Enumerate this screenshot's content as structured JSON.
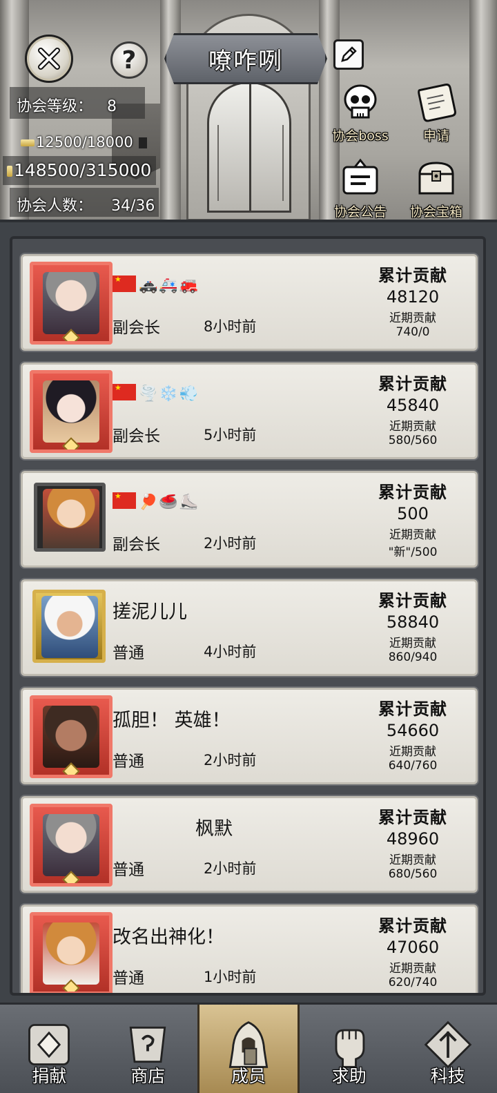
{
  "guild": {
    "name": "嘹咋咧",
    "level_label": "协会等级：",
    "level_value": "8",
    "exp_text": "12500/18000",
    "funds_text": "148500/315000",
    "members_label": "协会人数：",
    "members_value": "34/36"
  },
  "header_buttons": {
    "boss": "协会boss",
    "apply": "申请",
    "notice": "协会公告",
    "treasure": "协会宝箱"
  },
  "member_labels": {
    "total_title": "累计贡献",
    "recent_title": "近期贡献"
  },
  "members": [
    {
      "name": "",
      "badges": [
        "flag-cn",
        "🚓",
        "🚑",
        "🚒"
      ],
      "role": "副会长",
      "last_seen": "8小时前",
      "total": "48120",
      "recent": "740/0"
    },
    {
      "name": "",
      "badges": [
        "flag-cn",
        "🌪️",
        "❄️",
        "💨"
      ],
      "role": "副会长",
      "last_seen": "5小时前",
      "total": "45840",
      "recent": "580/560"
    },
    {
      "name": "",
      "badges": [
        "flag-cn",
        "🏓",
        "🥌",
        "⛸️"
      ],
      "role": "副会长",
      "last_seen": "2小时前",
      "total": "500",
      "recent": "\"新\"/500"
    },
    {
      "name": "搓泥儿儿",
      "badges": [],
      "role": "普通",
      "last_seen": "4小时前",
      "total": "58840",
      "recent": "860/940"
    },
    {
      "name": "孤胆！ 英雄！",
      "badges": [],
      "role": "普通",
      "last_seen": "2小时前",
      "total": "54660",
      "recent": "640/760"
    },
    {
      "name": "枫默",
      "badges": [],
      "role": "普通",
      "last_seen": "2小时前",
      "total": "48960",
      "recent": "680/560"
    },
    {
      "name": "改名出神化！",
      "badges": [],
      "role": "普通",
      "last_seen": "1小时前",
      "total": "47060",
      "recent": "620/740"
    }
  ],
  "nav": {
    "donate": "捐献",
    "shop": "商店",
    "members": "成员",
    "help": "求助",
    "tech": "科技"
  }
}
